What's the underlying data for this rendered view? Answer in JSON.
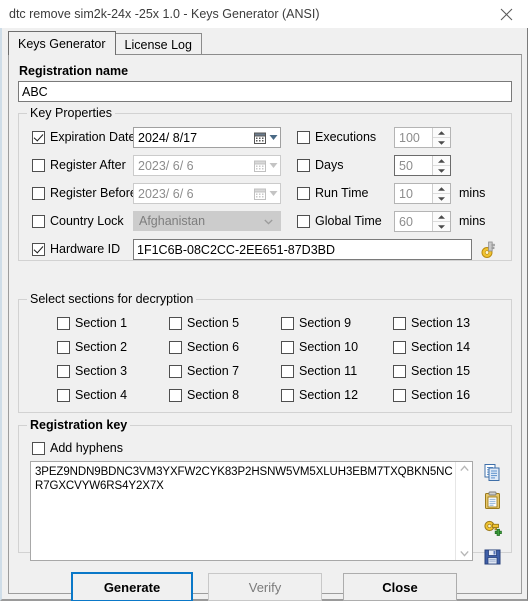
{
  "window": {
    "title": "dtc remove sim2k-24x -25x 1.0 - Keys Generator (ANSI)",
    "close_icon": "close-icon"
  },
  "tabs": [
    {
      "label": "Keys Generator",
      "active": true
    },
    {
      "label": "License Log",
      "active": false
    }
  ],
  "registration_name": {
    "label": "Registration name",
    "value": "ABC"
  },
  "key_properties": {
    "group_title": "Key Properties",
    "left_rows": [
      {
        "label": "Expiration Date",
        "checked": true,
        "value": "2024/ 8/17",
        "enabled": true
      },
      {
        "label": "Register After",
        "checked": false,
        "value": "2023/ 6/ 6",
        "enabled": false
      },
      {
        "label": "Register Before",
        "checked": false,
        "value": "2023/ 6/ 6",
        "enabled": false
      }
    ],
    "country_lock": {
      "label": "Country Lock",
      "checked": false,
      "value": "Afghanistan"
    },
    "hardware_id": {
      "label": "Hardware ID",
      "checked": true,
      "value": "1F1C6B-08C2CC-2EE651-87D3BD",
      "key_icon": "key-icon"
    },
    "right_rows": [
      {
        "label": "Executions",
        "checked": false,
        "value": "100",
        "unit": ""
      },
      {
        "label": "Days",
        "checked": false,
        "value": "50",
        "unit": ""
      },
      {
        "label": "Run Time",
        "checked": false,
        "value": "10",
        "unit": "mins"
      },
      {
        "label": "Global Time",
        "checked": false,
        "value": "60",
        "unit": "mins"
      }
    ]
  },
  "sections": {
    "group_title": "Select sections for decryption",
    "items": [
      {
        "label": "Section 1",
        "checked": false
      },
      {
        "label": "Section 2",
        "checked": false
      },
      {
        "label": "Section 3",
        "checked": false
      },
      {
        "label": "Section 4",
        "checked": false
      },
      {
        "label": "Section 5",
        "checked": false
      },
      {
        "label": "Section 6",
        "checked": false
      },
      {
        "label": "Section 7",
        "checked": false
      },
      {
        "label": "Section 8",
        "checked": false
      },
      {
        "label": "Section 9",
        "checked": false
      },
      {
        "label": "Section 10",
        "checked": false
      },
      {
        "label": "Section 11",
        "checked": false
      },
      {
        "label": "Section 12",
        "checked": false
      },
      {
        "label": "Section 13",
        "checked": false
      },
      {
        "label": "Section 14",
        "checked": false
      },
      {
        "label": "Section 15",
        "checked": false
      },
      {
        "label": "Section 16",
        "checked": false
      }
    ]
  },
  "registration_key": {
    "group_title": "Registration key",
    "add_hyphens": {
      "label": "Add hyphens",
      "checked": false
    },
    "key_text": "3PEZ9NDN9BDNC3VM3YXFW2CYK83P2HSNW5VM5XLUH3EBM7TXQBKN5NCR7GXCVYW6RS4Y2X7X",
    "tools": [
      {
        "name": "copy-icon"
      },
      {
        "name": "paste-icon"
      },
      {
        "name": "add-key-icon"
      },
      {
        "name": "save-icon"
      }
    ]
  },
  "buttons": {
    "generate": "Generate",
    "verify": "Verify",
    "close": "Close"
  },
  "colors": {
    "accent": "#0a78c8",
    "dialog_bg": "#f0f0f0",
    "key_gold": "#e8b313"
  }
}
